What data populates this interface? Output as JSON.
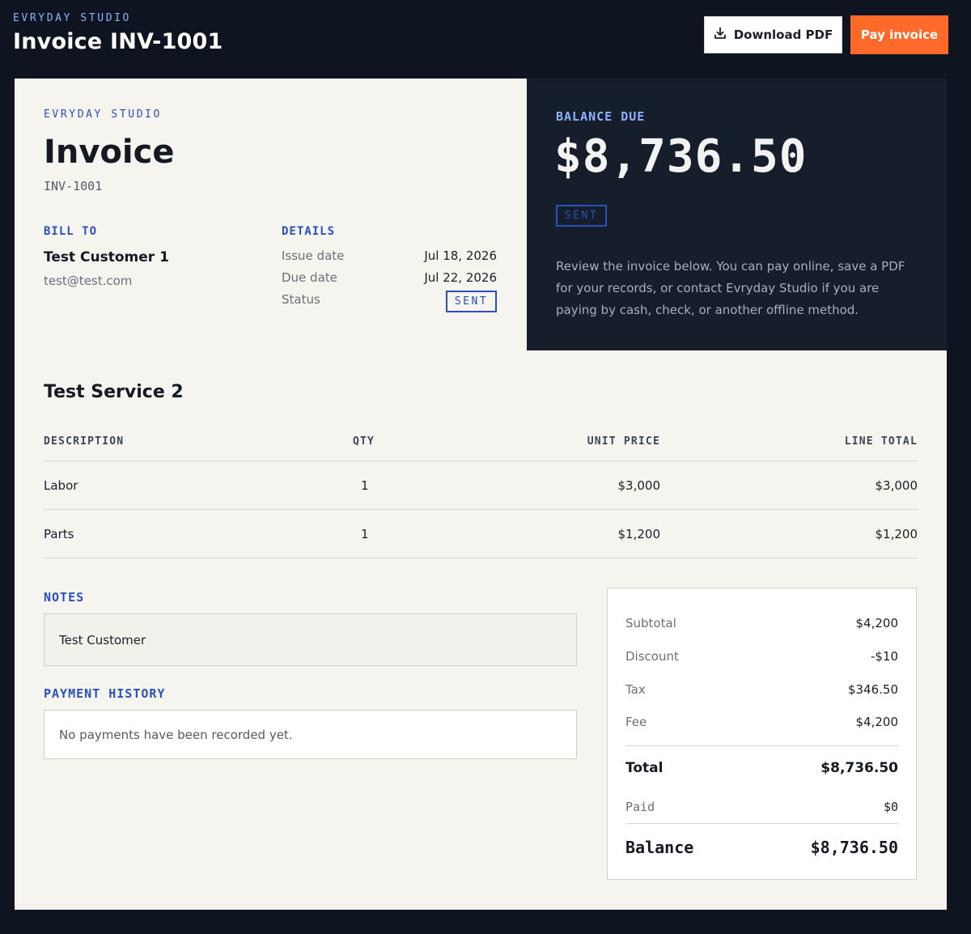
{
  "header": {
    "brand": "EVRYDAY STUDIO",
    "title": "Invoice INV-1001",
    "download_label": "Download PDF",
    "pay_label": "Pay invoice"
  },
  "invoice": {
    "brand": "EVRYDAY STUDIO",
    "heading": "Invoice",
    "number": "INV-1001",
    "bill_to_label": "BILL TO",
    "customer_name": "Test Customer 1",
    "customer_email": "test@test.com",
    "details_label": "DETAILS",
    "details": [
      {
        "label": "Issue date",
        "value": "Jul 18, 2026"
      },
      {
        "label": "Due date",
        "value": "Jul 22, 2026"
      },
      {
        "label": "Status",
        "value": "SENT"
      }
    ]
  },
  "balance": {
    "label": "BALANCE DUE",
    "amount": "$8,736.50",
    "status": "SENT",
    "description": "Review the invoice below. You can pay online, save a PDF for your records, or contact Evryday Studio if you are paying by cash, check, or another offline method."
  },
  "service": {
    "title": "Test Service 2",
    "columns": [
      "DESCRIPTION",
      "QTY",
      "UNIT PRICE",
      "LINE TOTAL"
    ],
    "rows": [
      {
        "description": "Labor",
        "qty": "1",
        "unit_price": "$3,000",
        "line_total": "$3,000"
      },
      {
        "description": "Parts",
        "qty": "1",
        "unit_price": "$1,200",
        "line_total": "$1,200"
      }
    ]
  },
  "notes": {
    "label": "NOTES",
    "text": "Test Customer"
  },
  "payment_history": {
    "label": "PAYMENT HISTORY",
    "empty_text": "No payments have been recorded yet."
  },
  "totals": {
    "subtotal_label": "Subtotal",
    "subtotal": "$4,200",
    "discount_label": "Discount",
    "discount": "-$10",
    "tax_label": "Tax",
    "tax": "$346.50",
    "fee_label": "Fee",
    "fee": "$4,200",
    "total_label": "Total",
    "total": "$8,736.50",
    "paid_label": "Paid",
    "paid": "$0",
    "balance_label": "Balance",
    "balance": "$8,736.50"
  },
  "colors": {
    "page_background": "#0f1520",
    "card_background": "#f5f4ef",
    "panel_background": "#161d2b",
    "accent_blue": "#2a4fbf",
    "pay_button": "#ff6a2a"
  },
  "icons": {
    "download": "download-icon"
  }
}
